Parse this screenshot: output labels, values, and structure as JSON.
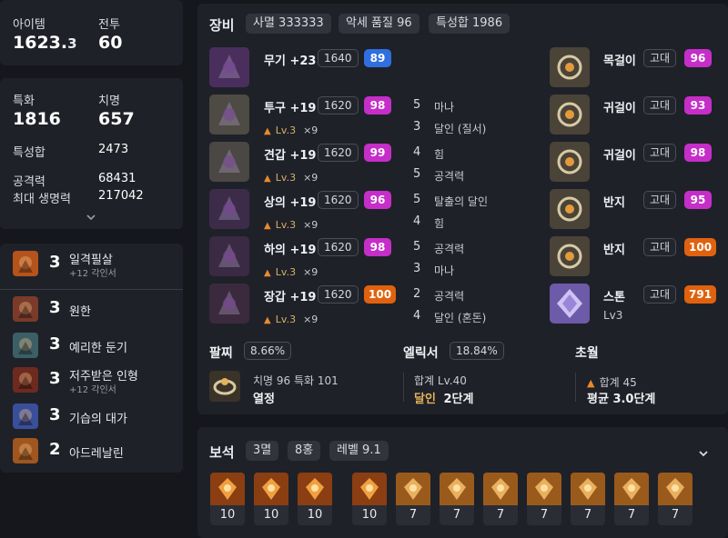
{
  "summary": {
    "item_label": "아이템",
    "item_value": "1623.",
    "item_value_small": "3",
    "battle_label": "전투",
    "battle_value": "60"
  },
  "stats": {
    "spec_label": "특화",
    "spec_value": "1816",
    "crit_label": "치명",
    "crit_value": "657",
    "total_label": "특성합",
    "total_value": "2473",
    "atk_label": "공격력",
    "atk_value": "68431",
    "hp_label": "최대 생명력",
    "hp_value": "217042"
  },
  "engravings": [
    {
      "num": "3",
      "name": "일격필살",
      "sub": "+12 각인서",
      "color": "#b5531c"
    },
    {
      "num": "3",
      "name": "원한",
      "sub": "",
      "color": "#7a3b2a"
    },
    {
      "num": "3",
      "name": "예리한 둔기",
      "sub": "",
      "color": "#3c5f66"
    },
    {
      "num": "3",
      "name": "저주받은 인형",
      "sub": "+12 각인서",
      "color": "#6d2a1f"
    },
    {
      "num": "3",
      "name": "기습의 대가",
      "sub": "",
      "color": "#3a4f9a"
    },
    {
      "num": "2",
      "name": "아드레날린",
      "sub": "",
      "color": "#a0561e"
    }
  ],
  "equip": {
    "title": "장비",
    "tag1": "사멸 333333",
    "tag2": "악세 품질 96",
    "tag3": "특성합 1986",
    "armor": [
      {
        "name": "무기 +23",
        "level": "1640",
        "quality": "89",
        "qclass": "q-blue",
        "lv": "",
        "mult": "",
        "s1n": "",
        "s1": "",
        "s2n": "",
        "s2": ""
      },
      {
        "name": "투구 +19",
        "level": "1620",
        "quality": "98",
        "qclass": "q-mag",
        "lv": "Lv.3",
        "mult": "×9",
        "s1n": "5",
        "s1": "마나",
        "s2n": "3",
        "s2": "달인 (질서)"
      },
      {
        "name": "견갑 +19",
        "level": "1620",
        "quality": "99",
        "qclass": "q-mag",
        "lv": "Lv.3",
        "mult": "×9",
        "s1n": "4",
        "s1": "힘",
        "s2n": "5",
        "s2": "공격력"
      },
      {
        "name": "상의 +19",
        "level": "1620",
        "quality": "96",
        "qclass": "q-mag",
        "lv": "Lv.3",
        "mult": "×9",
        "s1n": "5",
        "s1": "탈출의 달인",
        "s2n": "4",
        "s2": "힘"
      },
      {
        "name": "하의 +19",
        "level": "1620",
        "quality": "98",
        "qclass": "q-mag",
        "lv": "Lv.3",
        "mult": "×9",
        "s1n": "5",
        "s1": "공격력",
        "s2n": "3",
        "s2": "마나"
      },
      {
        "name": "장갑 +19",
        "level": "1620",
        "quality": "100",
        "qclass": "q-org",
        "lv": "Lv.3",
        "mult": "×9",
        "s1n": "2",
        "s1": "공격력",
        "s2n": "4",
        "s2": "달인 (혼돈)"
      }
    ],
    "acc": [
      {
        "name": "목걸이",
        "grade": "고대",
        "quality": "96",
        "qclass": "q-mag"
      },
      {
        "name": "귀걸이",
        "grade": "고대",
        "quality": "93",
        "qclass": "q-mag"
      },
      {
        "name": "귀걸이",
        "grade": "고대",
        "quality": "98",
        "qclass": "q-mag"
      },
      {
        "name": "반지",
        "grade": "고대",
        "quality": "95",
        "qclass": "q-mag"
      },
      {
        "name": "반지",
        "grade": "고대",
        "quality": "100",
        "qclass": "q-org"
      },
      {
        "name": "스톤",
        "grade": "고대",
        "quality": "791",
        "qclass": "q-org",
        "sub": "Lv3"
      }
    ],
    "bracelet": {
      "label": "팔찌",
      "pct": "8.66%",
      "line1": "치명 96  특화 101",
      "line2": "열정"
    },
    "elixir": {
      "label": "엘릭서",
      "pct": "18.84%",
      "line1": "합계 Lv.40",
      "line2a": "달인",
      "line2b": "2단계"
    },
    "trans": {
      "label": "초월",
      "line1": "합계 45",
      "line2": "평균 3.0단계"
    }
  },
  "gems": {
    "title": "보석",
    "tag1": "3멸",
    "tag2": "8홍",
    "tag3": "레벨 9.1",
    "levels": [
      "10",
      "10",
      "10",
      "10",
      "7",
      "7",
      "7",
      "7",
      "7",
      "7",
      "7"
    ]
  }
}
